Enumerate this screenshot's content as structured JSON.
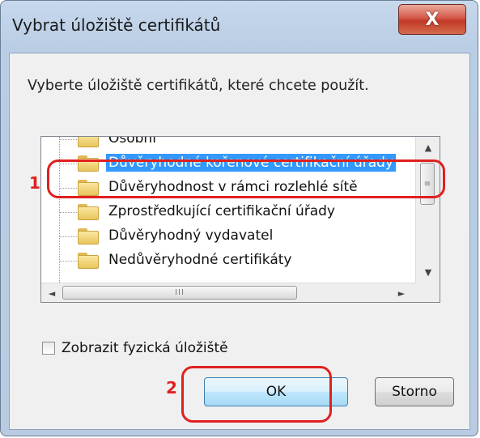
{
  "window": {
    "title": "Vybrat úložiště certifikátů",
    "close_label": "X"
  },
  "instruction": "Vyberte úložiště certifikátů, které chcete použít.",
  "tree": {
    "items": [
      {
        "label": "Osobní",
        "selected": false
      },
      {
        "label": "Důvěryhodné kořenové certifikační úřady",
        "selected": true
      },
      {
        "label": "Důvěryhodnost v rámci rozlehlé sítě",
        "selected": false
      },
      {
        "label": "Zprostředkující certifikační úřady",
        "selected": false
      },
      {
        "label": "Důvěryhodný vydavatel",
        "selected": false
      },
      {
        "label": "Nedůvěryhodné certifikáty",
        "selected": false
      }
    ],
    "scroll_up_icon": "▲",
    "scroll_down_icon": "▼",
    "scroll_left_icon": "◄",
    "scroll_right_icon": "►",
    "vthumb_grip": "≡",
    "hthumb_grip": "III"
  },
  "checkbox": {
    "label": "Zobrazit fyzická úložiště",
    "checked": false
  },
  "buttons": {
    "ok": "OK",
    "cancel": "Storno"
  },
  "annotations": {
    "step1": "1",
    "step2": "2",
    "color": "#e02020"
  },
  "colors": {
    "selection": "#3399ff",
    "frame": "#b9cde4"
  }
}
